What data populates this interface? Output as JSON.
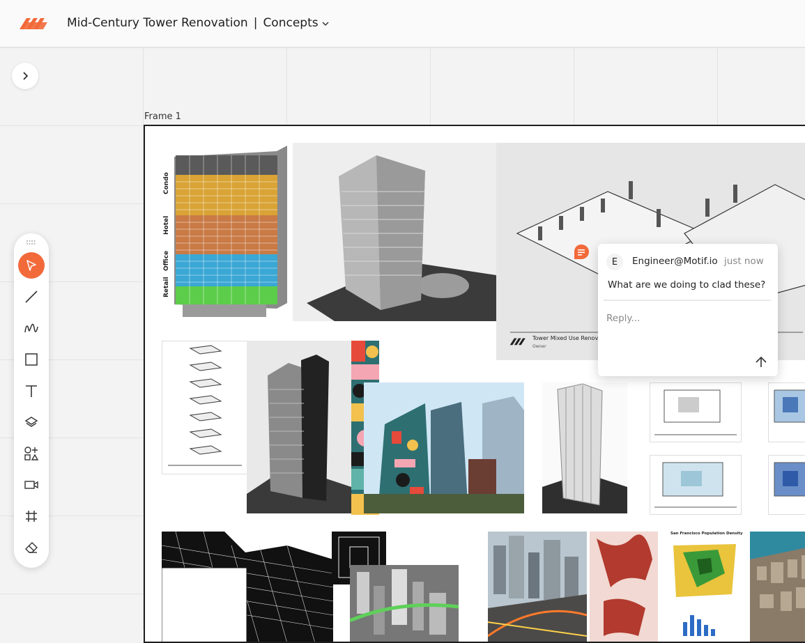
{
  "header": {
    "project_title": "Mid-Century Tower Renovation",
    "separator": "|",
    "page_name": "Concepts"
  },
  "canvas": {
    "frame_label": "Frame 1"
  },
  "board": {
    "section_labels": [
      "Condo",
      "Hotel",
      "Office",
      "Retail"
    ],
    "diagram_caption": "Tower Mixed Use Renovation",
    "diagram_subcaption": "Owner",
    "map_title": "San Francisco Population Density"
  },
  "comment": {
    "avatar_initial": "E",
    "author": "Engineer@Motif.io",
    "time": "just now",
    "text": "What are we doing to clad these?",
    "reply_placeholder": "Reply..."
  },
  "toolbar": {
    "tools": [
      "select-tool",
      "line-tool",
      "pen-tool",
      "rectangle-tool",
      "text-tool",
      "layers-tool",
      "shapes-tool",
      "video-tool",
      "frame-tool",
      "eraser-tool"
    ],
    "active_tool": "select-tool"
  },
  "colors": {
    "accent": "#f26a3a",
    "frame_border": "#1d1d1d",
    "canvas_bg": "#f3f3f3"
  }
}
